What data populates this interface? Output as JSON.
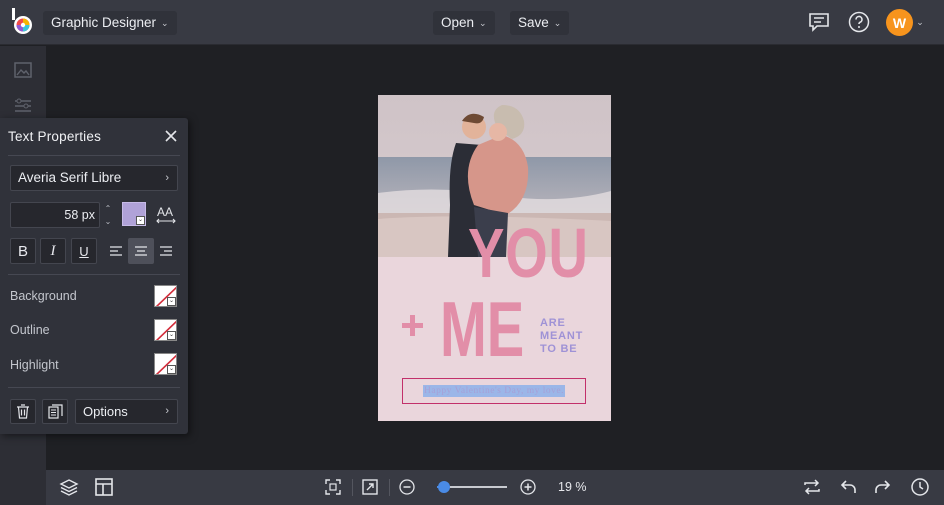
{
  "topbar": {
    "project_name": "Graphic Designer",
    "open_label": "Open",
    "save_label": "Save",
    "avatar_initial": "W",
    "icons": [
      "befunky-logo-icon",
      "comment-icon",
      "help-icon",
      "chevron-down-icon"
    ]
  },
  "text_properties": {
    "title": "Text Properties",
    "font_family": "Averia Serif Libre",
    "font_size": "58 px",
    "text_color": "#b0a2d8",
    "format_buttons": [
      "B",
      "I",
      "U"
    ],
    "background_label": "Background",
    "outline_label": "Outline",
    "highlight_label": "Highlight",
    "options_label": "Options"
  },
  "design": {
    "headline_top": "YOU",
    "headline_plus": "+",
    "headline_bottom": "ME",
    "side_text": [
      "ARE",
      "MEANT",
      "TO BE"
    ],
    "selected_text": "Happy Valentine's Day, my love.",
    "colors": {
      "pink": "#e28ea8",
      "lavender": "#9f92d6",
      "background": "#ead6dc",
      "selection": "#c2306a"
    }
  },
  "bottombar": {
    "zoom_value": 0.1,
    "zoom_label": "19 %"
  }
}
